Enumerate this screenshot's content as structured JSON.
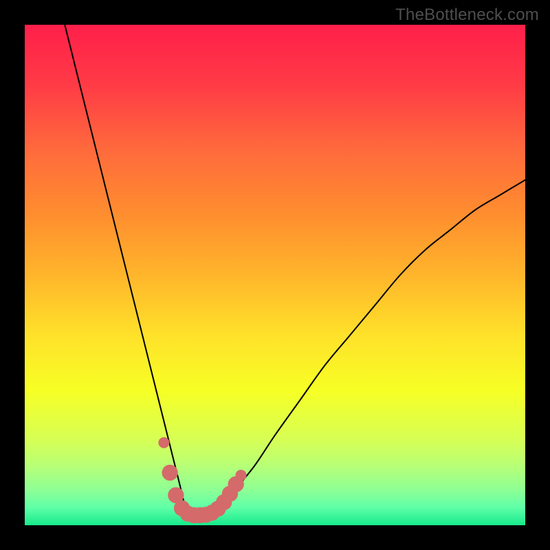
{
  "watermark": "TheBottleneck.com",
  "gradient_stops": [
    {
      "offset": 0.0,
      "color": "#ff1f4a"
    },
    {
      "offset": 0.12,
      "color": "#ff3b46"
    },
    {
      "offset": 0.25,
      "color": "#ff6a3c"
    },
    {
      "offset": 0.38,
      "color": "#ff8e2f"
    },
    {
      "offset": 0.5,
      "color": "#ffb52b"
    },
    {
      "offset": 0.62,
      "color": "#ffe12a"
    },
    {
      "offset": 0.73,
      "color": "#f7ff25"
    },
    {
      "offset": 0.83,
      "color": "#d6ff55"
    },
    {
      "offset": 0.88,
      "color": "#b8ff75"
    },
    {
      "offset": 0.93,
      "color": "#8dff95"
    },
    {
      "offset": 0.965,
      "color": "#5effa8"
    },
    {
      "offset": 1.0,
      "color": "#17e98b"
    }
  ],
  "chart_data": {
    "type": "line",
    "title": "",
    "xlabel": "",
    "ylabel": "",
    "xlim": [
      0,
      100
    ],
    "ylim": [
      0,
      100
    ],
    "series": [
      {
        "name": "bottleneck-curve",
        "x": [
          8,
          10,
          12,
          14,
          16,
          18,
          20,
          22,
          24,
          26,
          28,
          30,
          31,
          32,
          33,
          34,
          36,
          38,
          40,
          42,
          46,
          50,
          55,
          60,
          65,
          70,
          75,
          80,
          85,
          90,
          95,
          100
        ],
        "y": [
          100,
          92,
          84,
          76,
          68,
          60,
          52,
          44,
          36,
          28,
          20,
          12,
          8,
          4,
          2.5,
          2,
          2,
          2.5,
          4,
          7,
          12,
          18,
          25,
          32,
          38,
          44,
          50,
          55,
          59,
          63,
          66,
          69
        ]
      }
    ],
    "markers": {
      "name": "highlight-dots",
      "color": "#d46a6a",
      "points": [
        {
          "x": 27.8,
          "y": 16.5,
          "r": 1.1
        },
        {
          "x": 29.0,
          "y": 10.5,
          "r": 1.6
        },
        {
          "x": 30.2,
          "y": 6.0,
          "r": 1.6
        },
        {
          "x": 31.4,
          "y": 3.4,
          "r": 1.6
        },
        {
          "x": 32.6,
          "y": 2.3,
          "r": 1.6
        },
        {
          "x": 33.8,
          "y": 2.0,
          "r": 1.6
        },
        {
          "x": 35.0,
          "y": 2.0,
          "r": 1.6
        },
        {
          "x": 36.2,
          "y": 2.1,
          "r": 1.6
        },
        {
          "x": 37.4,
          "y": 2.5,
          "r": 1.6
        },
        {
          "x": 38.6,
          "y": 3.3,
          "r": 1.6
        },
        {
          "x": 39.8,
          "y": 4.6,
          "r": 1.6
        },
        {
          "x": 41.0,
          "y": 6.3,
          "r": 1.6
        },
        {
          "x": 42.2,
          "y": 8.2,
          "r": 1.6
        },
        {
          "x": 43.2,
          "y": 10,
          "r": 1.1
        }
      ]
    }
  }
}
